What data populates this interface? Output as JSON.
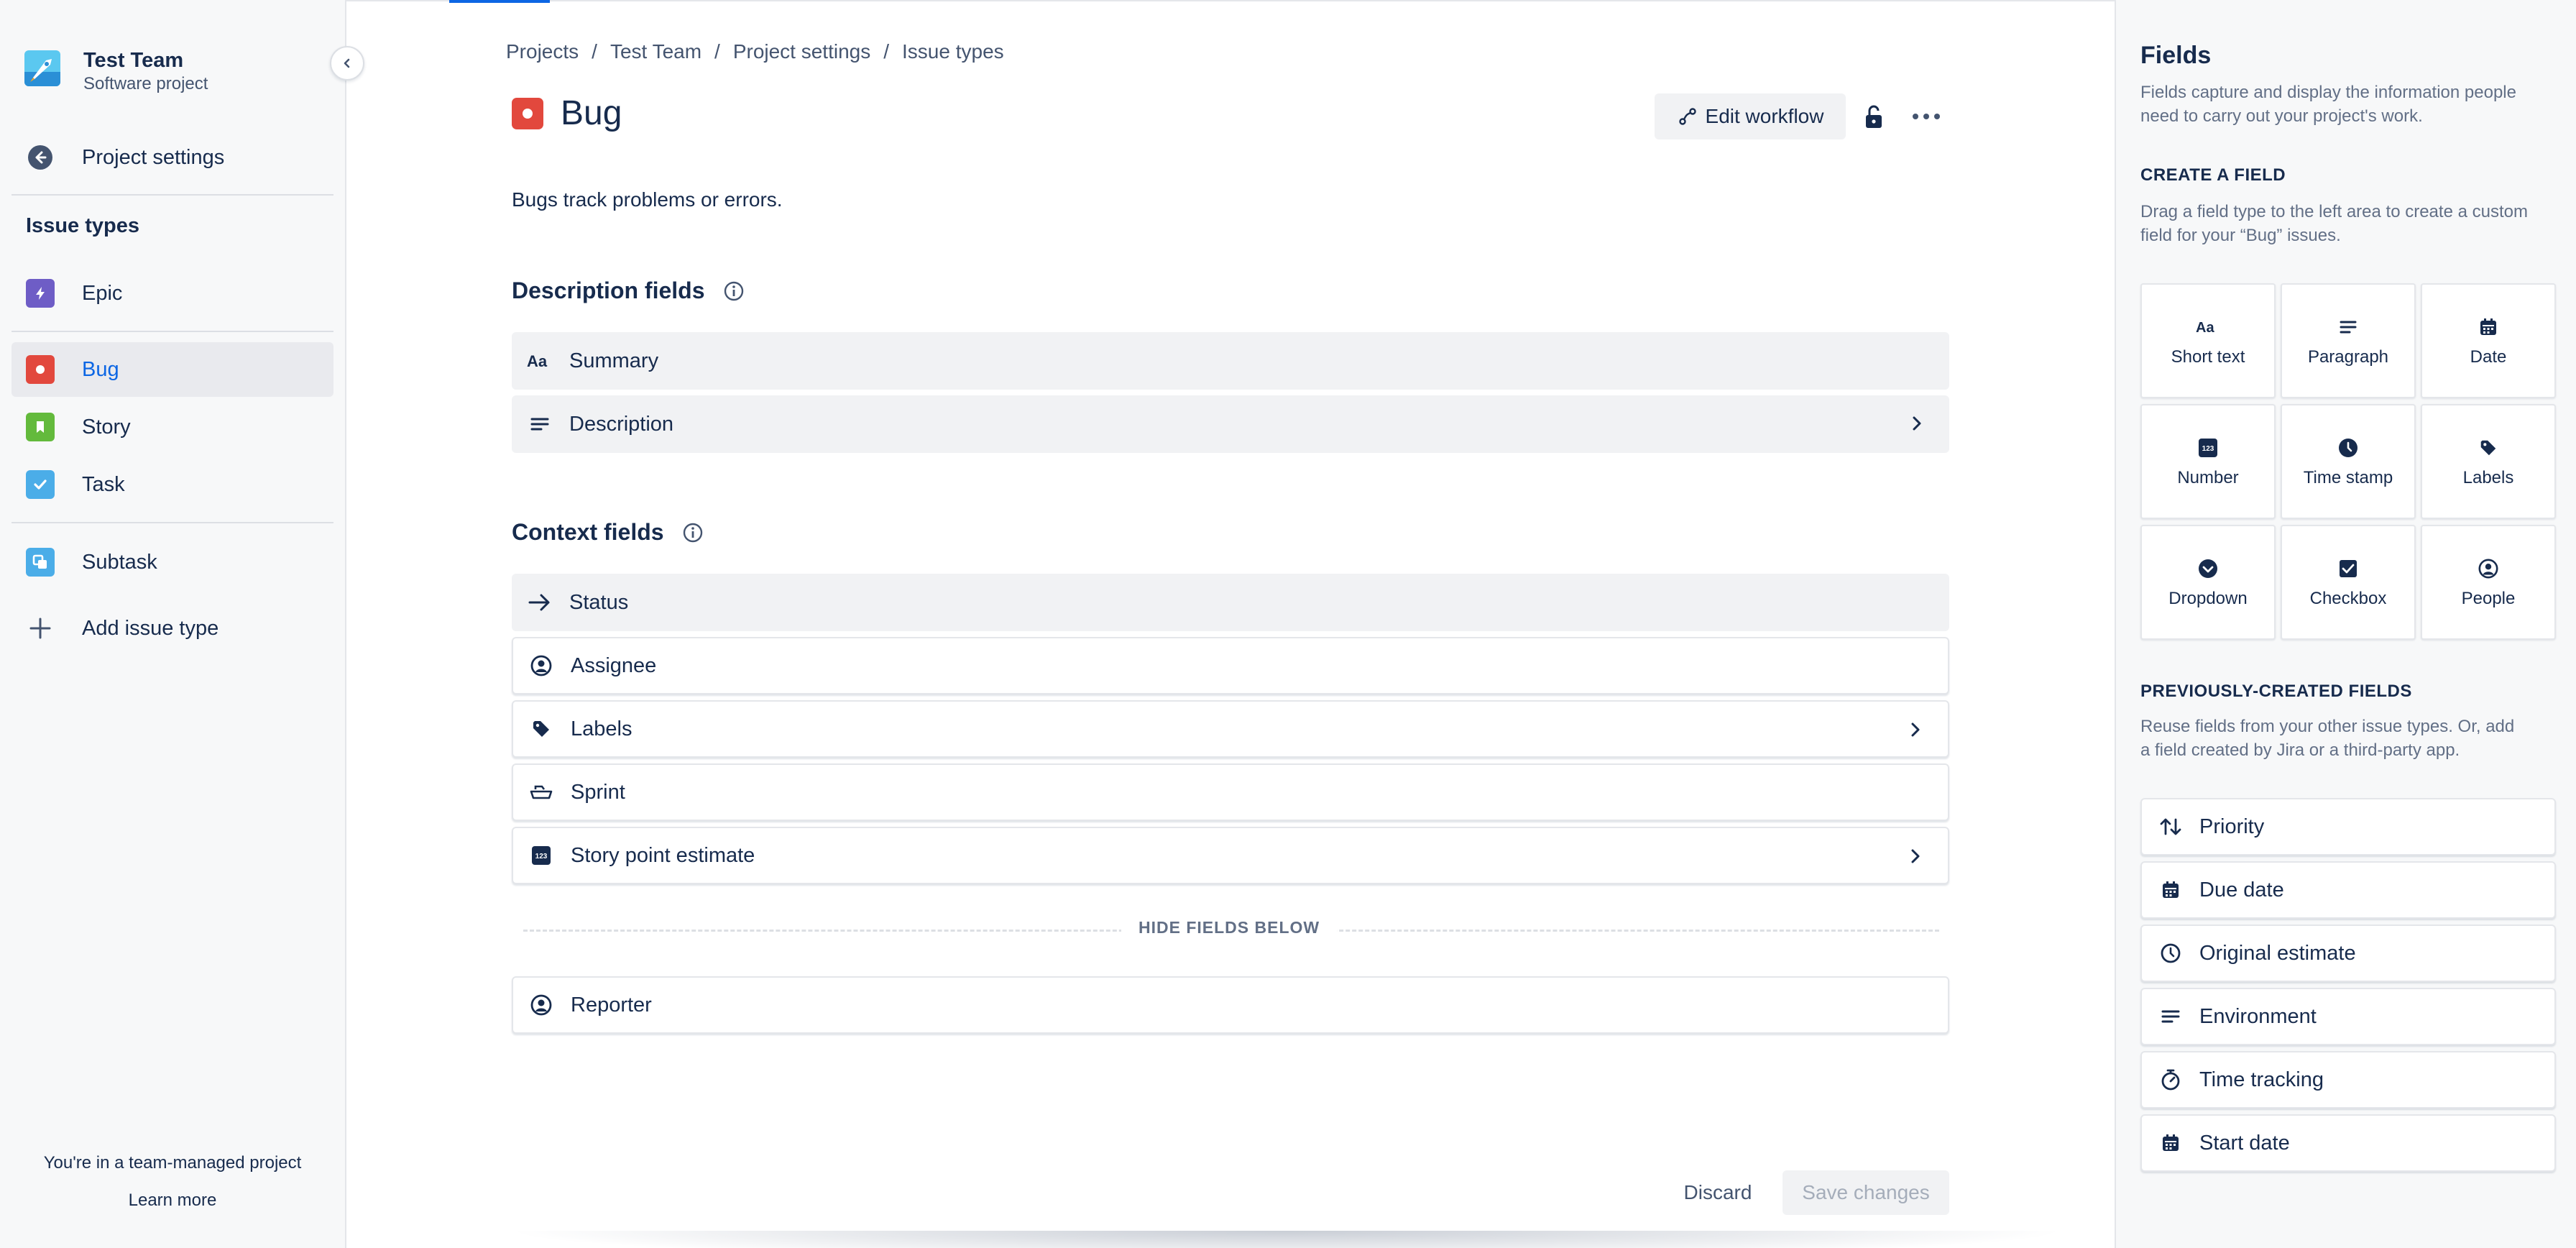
{
  "project": {
    "name": "Test Team",
    "type": "Software project"
  },
  "sidebar": {
    "settings_label": "Project settings",
    "heading": "Issue types",
    "items": [
      {
        "label": "Epic",
        "icon": "epic-icon",
        "color": "#6e5dc6"
      },
      {
        "label": "Bug",
        "icon": "bug-icon",
        "color": "#e2483d",
        "active": true
      },
      {
        "label": "Story",
        "icon": "story-icon",
        "color": "#63ba3c"
      },
      {
        "label": "Task",
        "icon": "task-icon",
        "color": "#4bade8"
      },
      {
        "label": "Subtask",
        "icon": "subtask-icon",
        "color": "#4bade8"
      }
    ],
    "add_label": "Add issue type",
    "footer_text": "You're in a team-managed project",
    "learn_more": "Learn more"
  },
  "breadcrumb": [
    "Projects",
    "Test Team",
    "Project settings",
    "Issue types"
  ],
  "breadcrumb_sep": "/",
  "issue": {
    "title": "Bug",
    "description": "Bugs track problems or errors.",
    "edit_workflow_label": "Edit workflow"
  },
  "description_section": {
    "title": "Description fields",
    "fields": [
      {
        "label": "Summary",
        "icon": "text-aa-icon"
      },
      {
        "label": "Description",
        "icon": "paragraph-icon"
      }
    ]
  },
  "context_section": {
    "title": "Context fields",
    "fields": [
      {
        "label": "Status",
        "icon": "arrow-right-icon"
      },
      {
        "label": "Assignee",
        "icon": "person-icon"
      },
      {
        "label": "Labels",
        "icon": "tag-icon"
      },
      {
        "label": "Sprint",
        "icon": "sprint-icon"
      },
      {
        "label": "Story point estimate",
        "icon": "number-icon"
      }
    ],
    "hide_label": "HIDE FIELDS BELOW",
    "hidden_fields": [
      {
        "label": "Reporter",
        "icon": "person-icon"
      }
    ]
  },
  "actions": {
    "discard": "Discard",
    "save": "Save changes"
  },
  "right_panel": {
    "title": "Fields",
    "intro": "Fields capture and display the information people need to carry out your project's work.",
    "create_heading": "CREATE A FIELD",
    "create_text": "Drag a field type to the left area to create a custom field for your “Bug” issues.",
    "field_types": [
      {
        "label": "Short text",
        "icon": "text-aa-icon"
      },
      {
        "label": "Paragraph",
        "icon": "paragraph-icon"
      },
      {
        "label": "Date",
        "icon": "calendar-icon"
      },
      {
        "label": "Number",
        "icon": "number-icon"
      },
      {
        "label": "Time stamp",
        "icon": "clock-icon"
      },
      {
        "label": "Labels",
        "icon": "tag-icon"
      },
      {
        "label": "Dropdown",
        "icon": "dropdown-icon"
      },
      {
        "label": "Checkbox",
        "icon": "checkbox-icon"
      },
      {
        "label": "People",
        "icon": "person-icon"
      }
    ],
    "previous_heading": "PREVIOUSLY-CREATED FIELDS",
    "previous_text": "Reuse fields from your other issue types. Or, add a field created by Jira or a third-party app.",
    "previous_fields": [
      {
        "label": "Priority",
        "icon": "priority-icon"
      },
      {
        "label": "Due date",
        "icon": "calendar-icon"
      },
      {
        "label": "Original estimate",
        "icon": "clock-icon"
      },
      {
        "label": "Environment",
        "icon": "paragraph-icon"
      },
      {
        "label": "Time tracking",
        "icon": "stopwatch-icon"
      },
      {
        "label": "Start date",
        "icon": "calendar-icon"
      }
    ]
  },
  "colors": {
    "accent": "#0c66e4",
    "text": "#172b4d",
    "bug": "#e2483d",
    "panel_bg": "#f7f8f9"
  }
}
